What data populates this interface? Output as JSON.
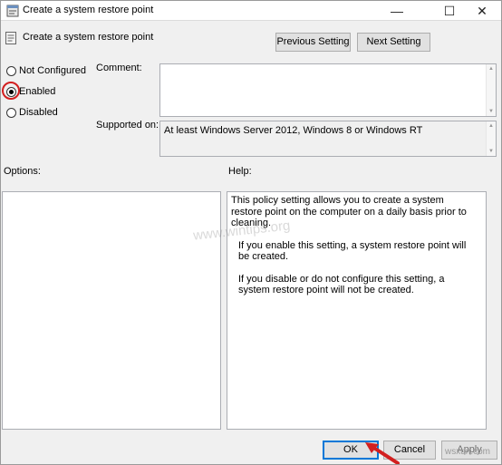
{
  "window": {
    "title": "Create a system restore point",
    "controls": {
      "minimize": "—",
      "maximize": "☐",
      "close": "✕"
    }
  },
  "policy": {
    "name": "Create a system restore point"
  },
  "nav": {
    "previous_label": "Previous Setting",
    "next_label": "Next Setting"
  },
  "state": {
    "options": [
      {
        "label": "Not Configured",
        "selected": false
      },
      {
        "label": "Enabled",
        "selected": true
      },
      {
        "label": "Disabled",
        "selected": false
      }
    ]
  },
  "comment": {
    "label": "Comment:",
    "value": ""
  },
  "supported": {
    "label": "Supported on:",
    "value": "At least Windows Server 2012, Windows 8 or Windows RT"
  },
  "options_panel": {
    "label": "Options:"
  },
  "help": {
    "label": "Help:",
    "paragraphs": [
      "This policy setting allows you to create a system restore point on the computer on a daily basis prior to cleaning.",
      "If you enable this setting, a system restore point will be created.",
      "If you disable or do not configure this setting, a system restore point will not be created."
    ]
  },
  "footer": {
    "ok_label": "OK",
    "cancel_label": "Cancel",
    "apply_label": "Apply"
  },
  "overlay": {
    "watermark": "www.wintips.org",
    "site_mark": "wsxdn.com"
  },
  "colors": {
    "highlight": "#d21f1f",
    "focus": "#0078d7",
    "window_bg": "#f0f0f0"
  }
}
